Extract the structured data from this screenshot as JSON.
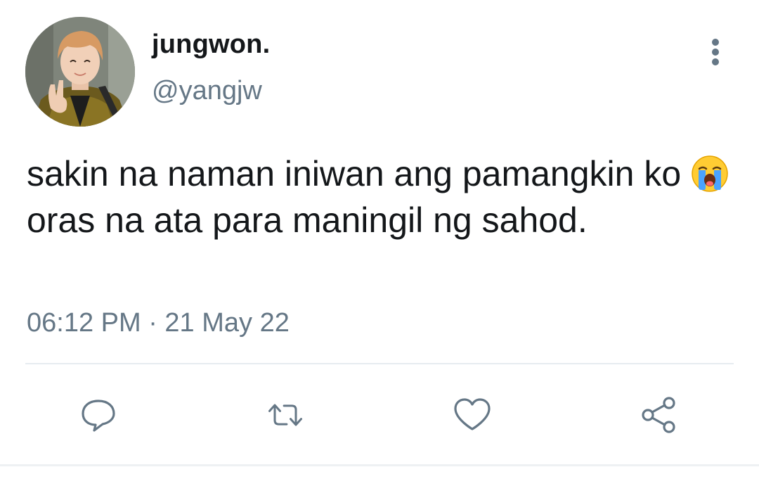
{
  "author": {
    "display_name": "jungwon.",
    "handle": "@yangjw",
    "avatar_icon": "profile-photo"
  },
  "tweet": {
    "text_part1": "sakin na naman iniwan ang pamangkin ko ",
    "emoji_icon": "loudly-crying-face-icon",
    "text_part2": " oras na ata para maningil ng sahod.",
    "timestamp": "06:12 PM · 21 May 22"
  },
  "actions": [
    {
      "name": "reply",
      "icon": "comment-icon"
    },
    {
      "name": "retweet",
      "icon": "retweet-icon"
    },
    {
      "name": "like",
      "icon": "heart-icon"
    },
    {
      "name": "share",
      "icon": "share-icon"
    }
  ],
  "menu": {
    "icon": "more-vertical-icon"
  },
  "colors": {
    "text": "#14171a",
    "secondary": "#657786",
    "divider": "#e6ecf0"
  }
}
